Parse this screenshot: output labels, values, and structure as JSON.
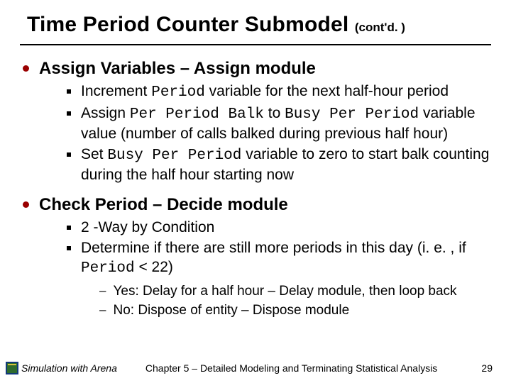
{
  "title": {
    "main": "Time Period Counter Submodel",
    "suffix": "(cont'd. )"
  },
  "sections": [
    {
      "heading": "Assign Variables – Assign module",
      "items": [
        {
          "runs": [
            {
              "t": "Increment "
            },
            {
              "t": "Period",
              "mono": true
            },
            {
              "t": " variable for the next half-hour period"
            }
          ]
        },
        {
          "runs": [
            {
              "t": "Assign "
            },
            {
              "t": "Per Period Balk",
              "mono": true
            },
            {
              "t": " to "
            },
            {
              "t": "Busy Per Period",
              "mono": true
            },
            {
              "t": " variable value (number of calls balked during previous half hour)"
            }
          ]
        },
        {
          "runs": [
            {
              "t": "Set "
            },
            {
              "t": "Busy Per Period",
              "mono": true
            },
            {
              "t": " variable to zero to start balk counting during the half hour starting now"
            }
          ]
        }
      ]
    },
    {
      "heading": "Check Period – Decide module",
      "items": [
        {
          "runs": [
            {
              "t": "2 -Way by Condition"
            }
          ]
        },
        {
          "runs": [
            {
              "t": "Determine if there are still more periods in this day (i. e. , if "
            },
            {
              "t": "Period",
              "mono": true
            },
            {
              "t": " < 22)"
            }
          ],
          "sub": [
            {
              "runs": [
                {
                  "t": "Yes:  Delay for a half hour – Delay module, then loop back"
                }
              ]
            },
            {
              "runs": [
                {
                  "t": "No:  Dispose of entity – Dispose module"
                }
              ]
            }
          ]
        }
      ]
    }
  ],
  "footer": {
    "book": "Simulation with Arena",
    "chapter": "Chapter 5 – Detailed Modeling and Terminating Statistical Analysis",
    "page": "29"
  }
}
